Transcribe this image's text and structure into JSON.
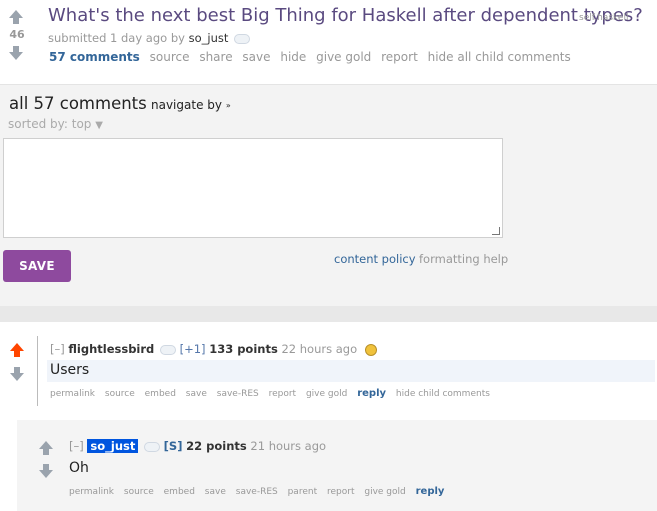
{
  "post": {
    "title": "What's the next best Big Thing for Haskell after dependent types?",
    "domain": "self.haskell",
    "score": "46",
    "tagline_prefix": "submitted 1 day ago by",
    "author": "so_just",
    "buttons": {
      "comments": "57 comments",
      "source": "source",
      "share": "share",
      "save": "save",
      "hide": "hide",
      "give_gold": "give gold",
      "report": "report",
      "hide_all_child": "hide all child comments"
    }
  },
  "comment_area": {
    "heading": "all 57 comments",
    "navigate_by": "navigate by",
    "navigate_by_chevron": "»",
    "sorted_by": "sorted by: top",
    "sorted_by_chevron": "▼",
    "textarea_value": "",
    "save_button": "SAVE",
    "content_policy": "content policy",
    "formatting_help": "formatting help"
  },
  "comments": [
    {
      "collapse": "[–]",
      "author": "flightlessbird",
      "tag": "[+1]",
      "points": "133 points",
      "time": "22 hours ago",
      "body": "Users",
      "actions": [
        "permalink",
        "source",
        "embed",
        "save",
        "save-RES",
        "report",
        "give gold"
      ],
      "reply": "reply",
      "extra_action": "hide child comments",
      "upvoted": true
    },
    {
      "collapse": "[–]",
      "author": "so_just",
      "tag": "[S]",
      "points": "22 points",
      "time": "21 hours ago",
      "body": "Oh",
      "actions": [
        "permalink",
        "source",
        "embed",
        "save",
        "save-RES",
        "parent",
        "report",
        "give gold"
      ],
      "reply": "reply"
    }
  ],
  "colors": {
    "upvote_active": "#ff4500",
    "link": "#336699",
    "save_button": "#8e4a9e",
    "op_badge": "#0055df"
  }
}
